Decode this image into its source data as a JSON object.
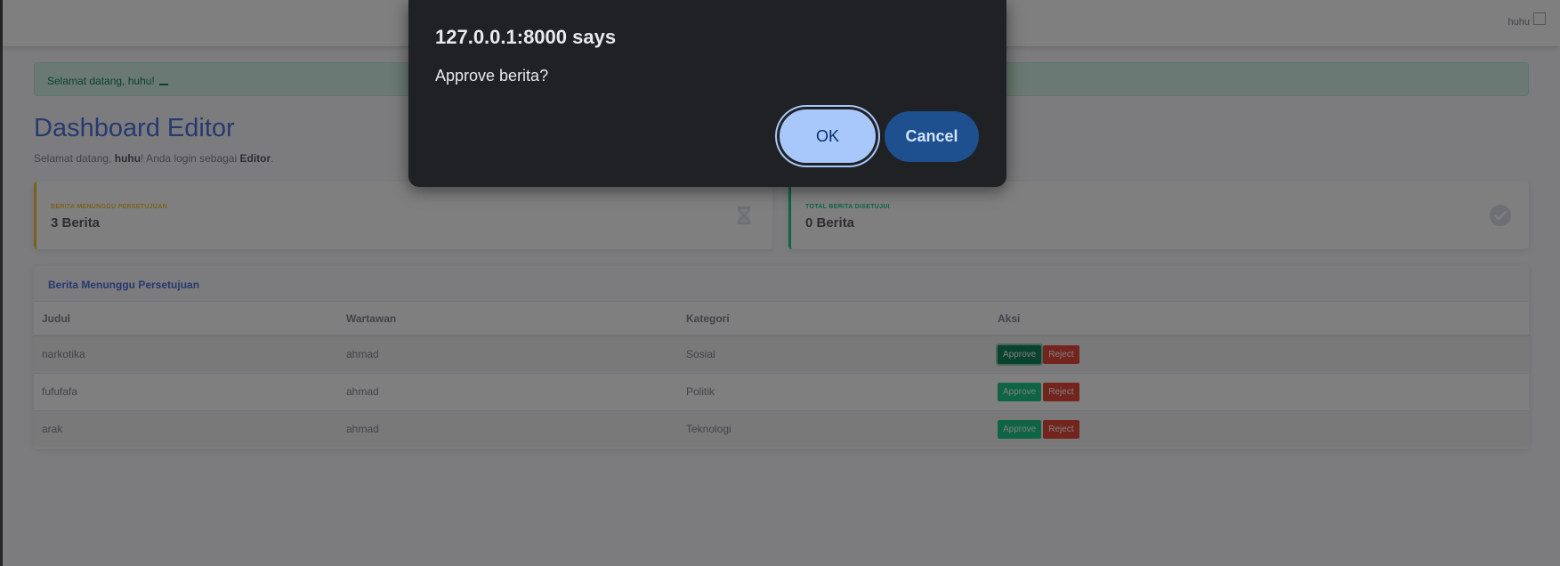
{
  "topbar": {
    "user_name": "huhu"
  },
  "alert": {
    "text": "Selamat datang, huhu!"
  },
  "page": {
    "title": "Dashboard Editor",
    "subtitle_prefix": "Selamat datang, ",
    "subtitle_user": "huhu",
    "subtitle_middle": "! Anda login sebagai ",
    "subtitle_role": "Editor",
    "subtitle_suffix": "."
  },
  "cards": {
    "pending": {
      "label": "BERITA MENUNGGU PERSETUJUAN",
      "value": "3 Berita",
      "icon": "hourglass-icon",
      "color": "#f6c23e"
    },
    "approved": {
      "label": "TOTAL BERITA DISETUJUI",
      "value": "0 Berita",
      "icon": "check-circle-icon",
      "color": "#1cc88a"
    }
  },
  "table": {
    "title": "Berita Menunggu Persetujuan",
    "columns": [
      "Judul",
      "Wartawan",
      "Kategori",
      "Aksi"
    ],
    "rows": [
      {
        "judul": "narkotika",
        "wartawan": "ahmad",
        "kategori": "Sosial"
      },
      {
        "judul": "fufufafa",
        "wartawan": "ahmad",
        "kategori": "Politik"
      },
      {
        "judul": "arak",
        "wartawan": "ahmad",
        "kategori": "Teknologi"
      }
    ],
    "approve_label": "Approve",
    "reject_label": "Reject"
  },
  "dialog": {
    "title": "127.0.0.1:8000 says",
    "message": "Approve berita?",
    "ok_label": "OK",
    "cancel_label": "Cancel"
  }
}
